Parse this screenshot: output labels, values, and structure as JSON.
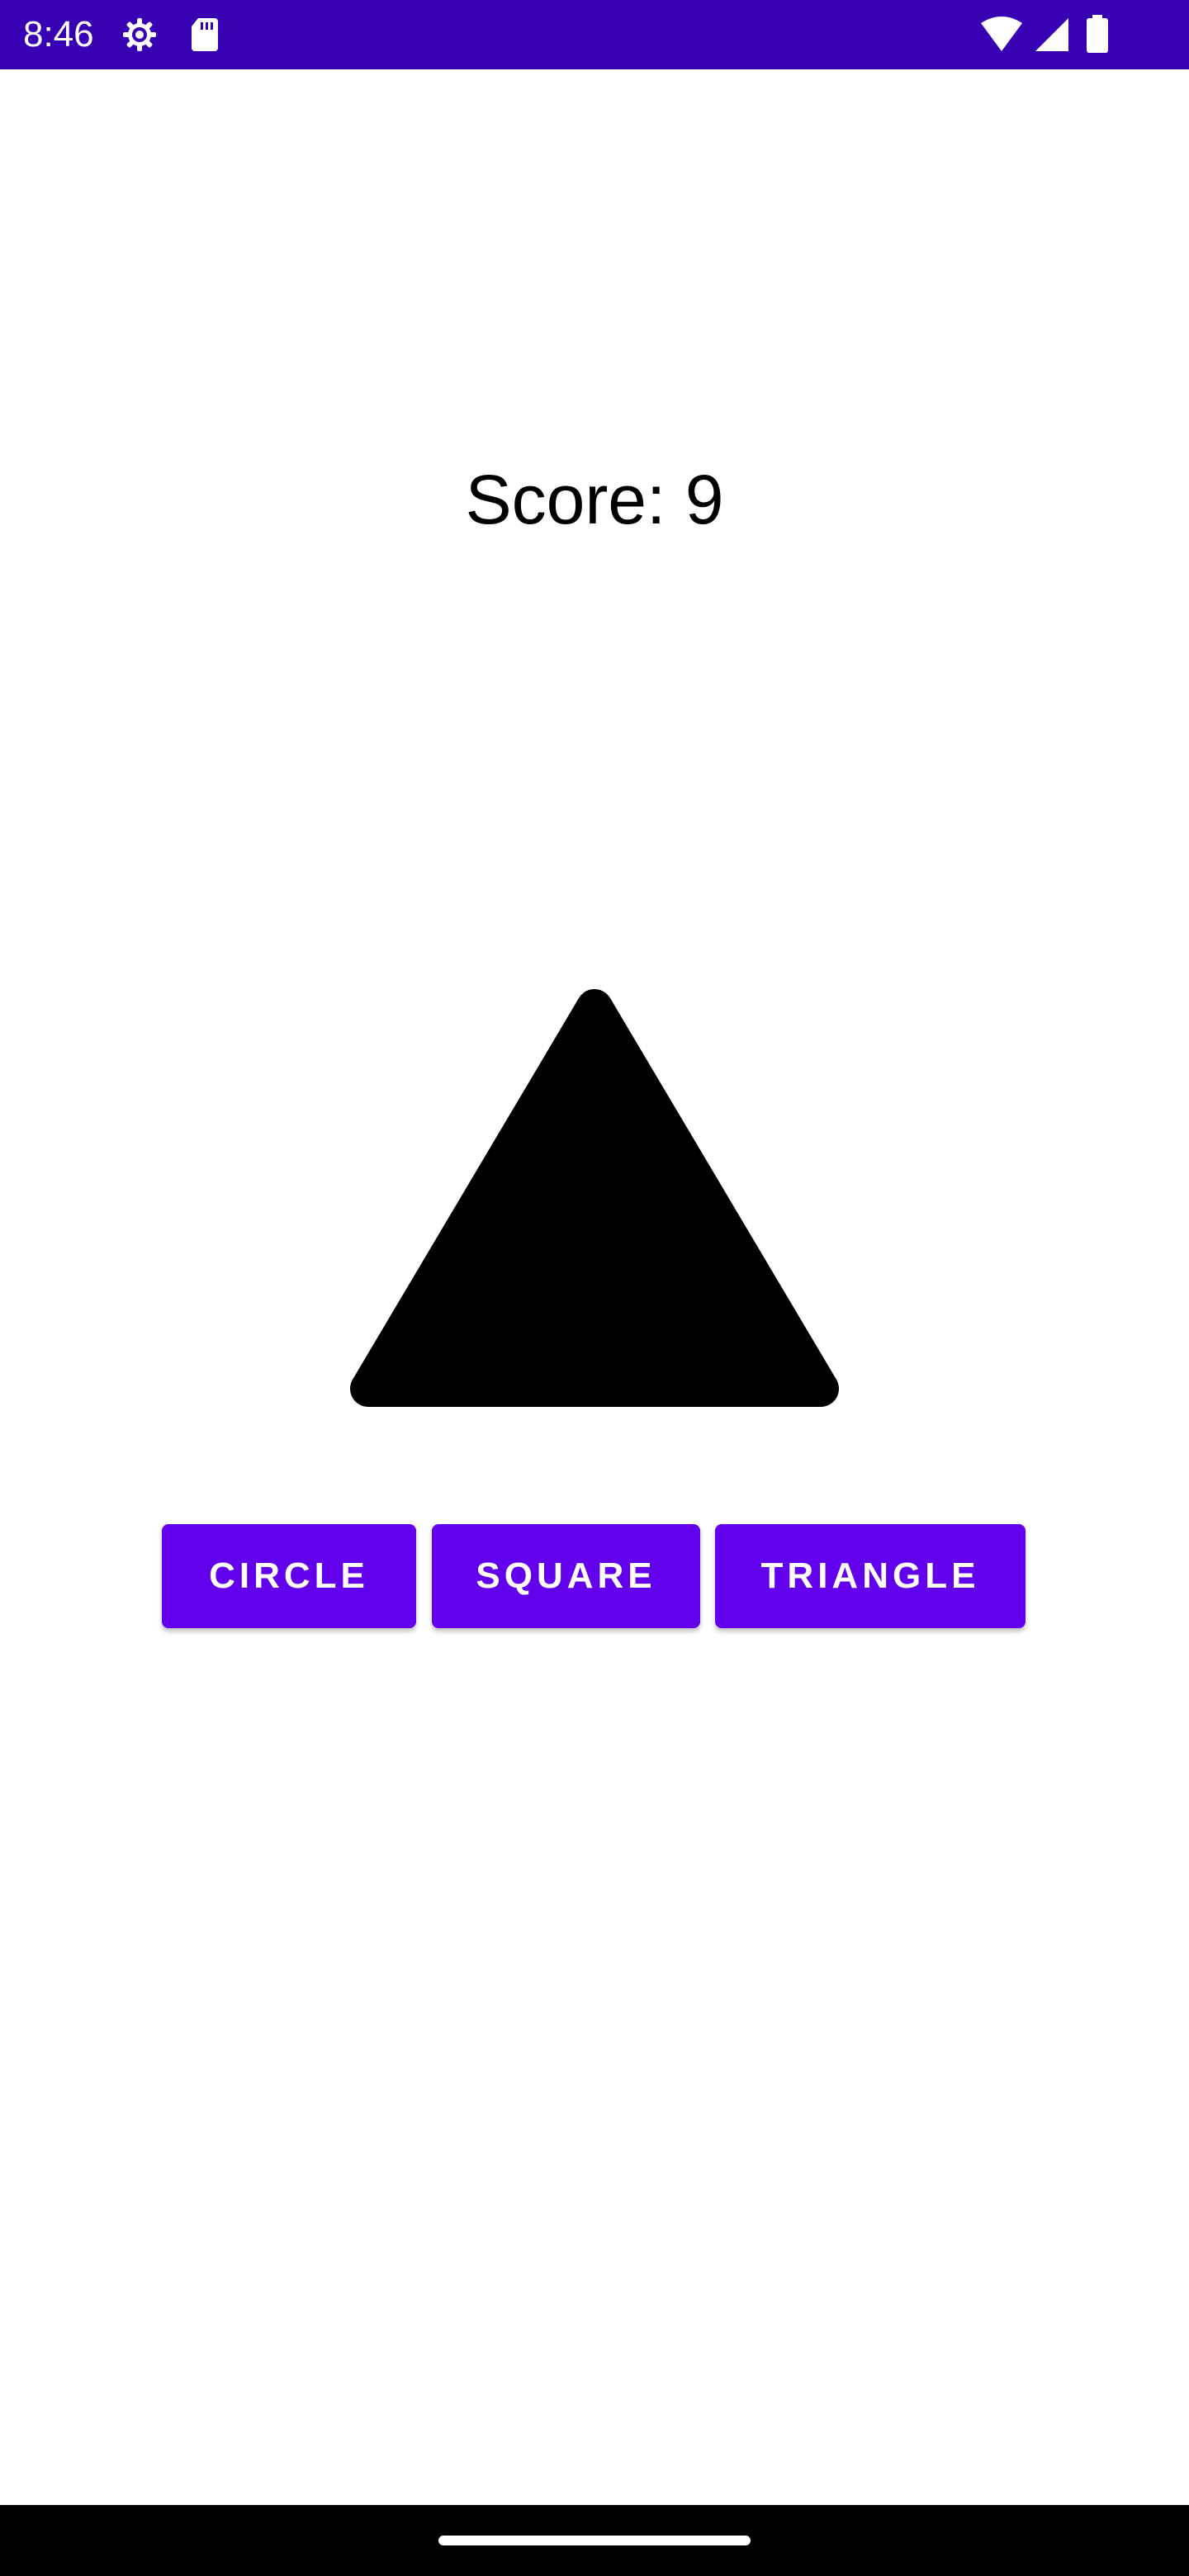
{
  "status_bar": {
    "time": "8:46",
    "icons_left": [
      "settings-icon",
      "sd-card-icon"
    ],
    "icons_right": [
      "wifi-icon",
      "signal-icon",
      "battery-icon"
    ],
    "background": "#3700b3"
  },
  "game": {
    "score_text": "Score: 9",
    "shape": "triangle",
    "shape_color": "#000000"
  },
  "buttons": {
    "circle_label": "CIRCLE",
    "square_label": "SQUARE",
    "triangle_label": "TRIANGLE",
    "color": "#6200ee"
  },
  "nav_bar": {
    "handle": "home-gesture-handle"
  }
}
